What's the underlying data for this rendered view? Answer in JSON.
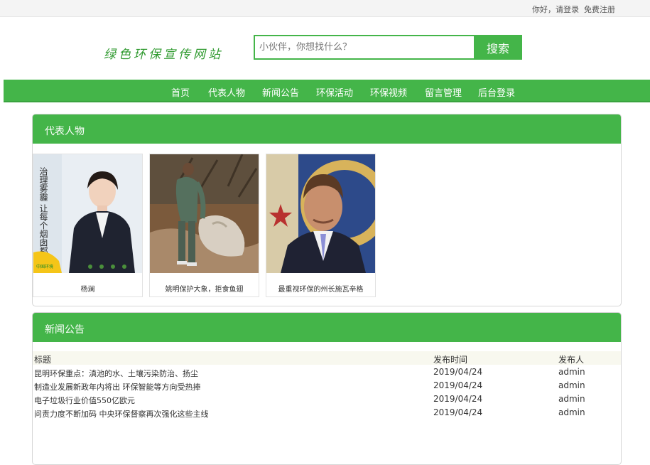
{
  "topbar": {
    "greeting": "你好，",
    "login": "请登录",
    "register": "免费注册"
  },
  "logo": {
    "text": "绿色环保宣传网站"
  },
  "search": {
    "placeholder": "小伙伴，你想找什么？",
    "button": "搜索"
  },
  "nav": {
    "items": [
      "首页",
      "代表人物",
      "新闻公告",
      "环保活动",
      "环保视频",
      "留言管理",
      "后台登录"
    ]
  },
  "people": {
    "title": "代表人物",
    "cards": [
      {
        "caption": "杨澜",
        "poster_text": "治理雾霾 让每个烟囱都公开",
        "poster_badge": "中国环境"
      },
      {
        "caption": "姚明保护大象，拒食鱼翅"
      },
      {
        "caption": "最重视环保的州长施瓦辛格"
      }
    ]
  },
  "news": {
    "title": "新闻公告",
    "headers": {
      "title": "标题",
      "date": "发布时间",
      "publisher": "发布人"
    },
    "rows": [
      {
        "title": "昆明环保重点：滇池的水、土壤污染防治、扬尘",
        "date": "2019/04/24",
        "publisher": "admin"
      },
      {
        "title": "制造业发展新政年内将出 环保智能等方向受热捧",
        "date": "2019/04/24",
        "publisher": "admin"
      },
      {
        "title": "电子垃圾行业价值550亿欧元",
        "date": "2019/04/24",
        "publisher": "admin"
      },
      {
        "title": "问责力度不断加码 中央环保督察再次强化这些主线",
        "date": "2019/04/24",
        "publisher": "admin"
      }
    ]
  },
  "colors": {
    "brand_green": "#44b549",
    "logo_green": "#2f9a2f",
    "table_header_bg": "#f8f8ef"
  }
}
